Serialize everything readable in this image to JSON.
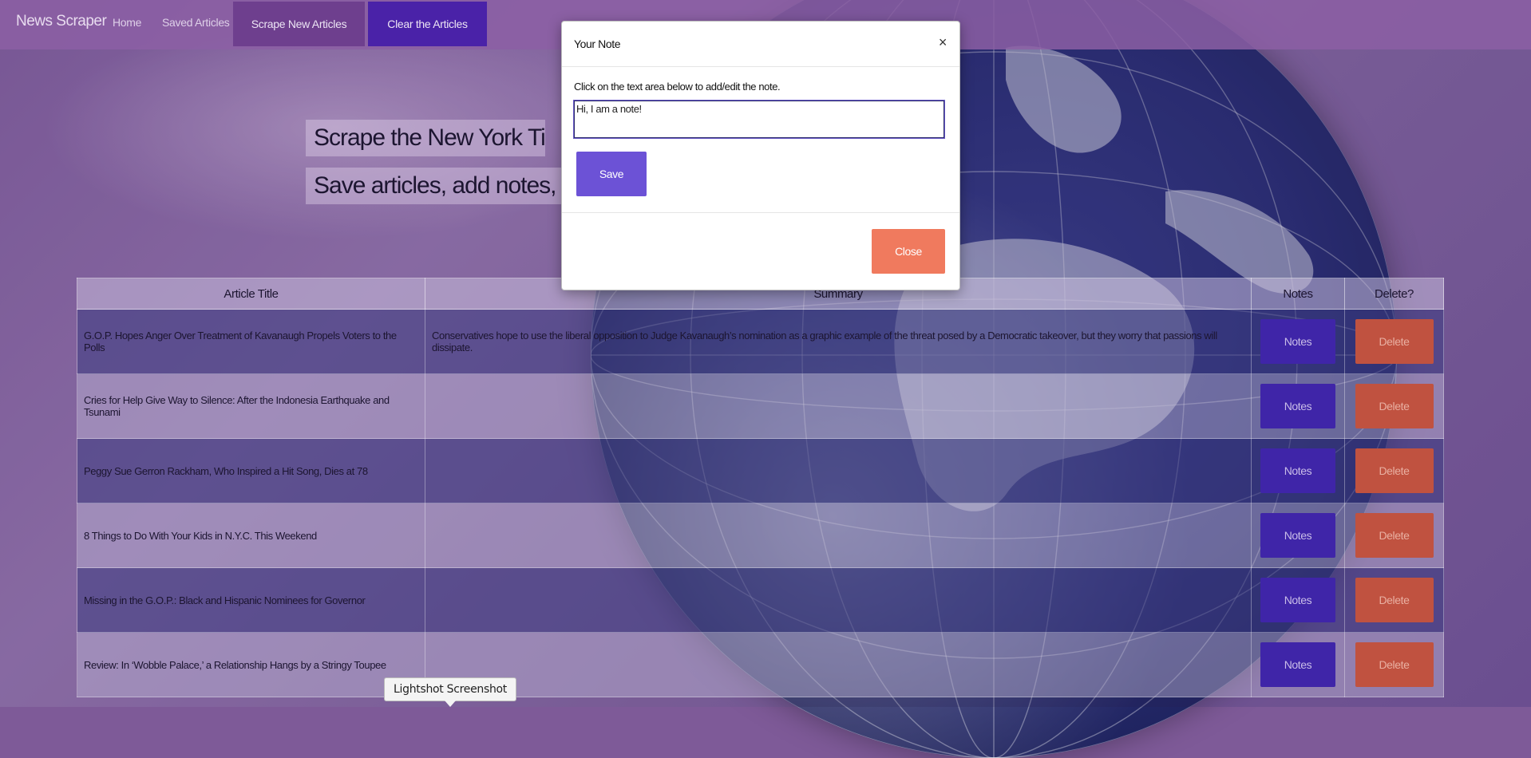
{
  "nav": {
    "brand": "News Scraper",
    "home": "Home",
    "saved": "Saved Articles",
    "scrape": "Scrape New Articles",
    "clear": "Clear the Articles",
    "colors": {
      "scrape_bg": "#6e3f8e",
      "clear_bg": "#4a22a8"
    }
  },
  "jumbotron": {
    "line1": "Scrape the New York Times!",
    "line2": "Save articles, add notes, and bui"
  },
  "table": {
    "headers": [
      "Article Title",
      "Summary",
      "Notes",
      "Delete?"
    ],
    "rows": [
      {
        "title": "G.O.P. Hopes Anger Over Treatment of Kavanaugh Propels Voters to the Polls",
        "summary": "Conservatives hope to use the liberal opposition to Judge Kavanaugh’s nomination as a graphic example of the threat posed by a Democratic takeover, but they worry that passions will dissipate.",
        "notes": "Notes",
        "delete": "Delete"
      },
      {
        "title": "Cries for Help Give Way to Silence: After the Indonesia Earthquake and Tsunami",
        "summary": "",
        "notes": "Notes",
        "delete": "Delete"
      },
      {
        "title": "Peggy Sue Gerron Rackham, Who Inspired a Hit Song, Dies at 78",
        "summary": "",
        "notes": "Notes",
        "delete": "Delete"
      },
      {
        "title": "8 Things to Do With Your Kids in N.Y.C. This Weekend",
        "summary": "",
        "notes": "Notes",
        "delete": "Delete"
      },
      {
        "title": "Missing in the G.O.P.: Black and Hispanic Nominees for Governor",
        "summary": "",
        "notes": "Notes",
        "delete": "Delete"
      },
      {
        "title": "Review: In ‘Wobble Palace,’ a Relationship Hangs by a Stringy Toupee",
        "summary": "",
        "notes": "Notes",
        "delete": "Delete"
      }
    ]
  },
  "modal": {
    "title": "Your Note",
    "close_icon": "×",
    "instructions": "Click on the text area below to add/edit the note.",
    "note_value": "Hi, I am a note!",
    "save": "Save",
    "close": "Close",
    "colors": {
      "save": "#6c52d6",
      "close": "#f07a5e"
    }
  },
  "tooltip": {
    "text": "Lightshot Screenshot"
  }
}
